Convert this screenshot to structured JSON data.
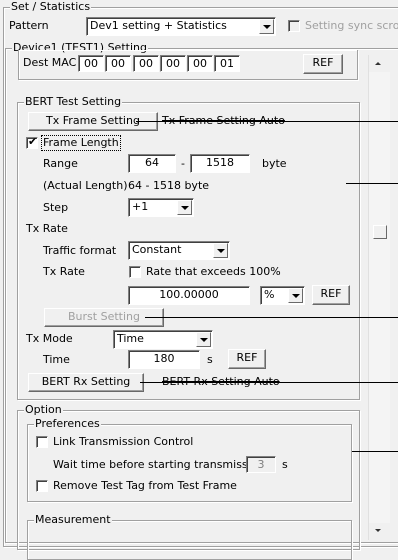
{
  "main_group": {
    "caption": "Set / Statistics"
  },
  "pattern": {
    "label": "Pattern",
    "value": "Dev1 setting + Statistics",
    "sync_label": "Setting sync scroll"
  },
  "device": {
    "caption": "Device1 (TEST1) Setting",
    "dest_mac_label": "Dest MAC",
    "mac_octets": [
      "00",
      "00",
      "00",
      "00",
      "00",
      "01"
    ],
    "ref_label": "REF"
  },
  "bert": {
    "caption": "BERT Test Setting",
    "tx_frame_button": "Tx Frame Setting",
    "tx_frame_auto": "Tx Frame Setting Auto",
    "frame_length_label": "Frame Length",
    "range_label": "Range",
    "range_min": "64",
    "range_sep": "-",
    "range_max": "1518",
    "range_unit": "byte",
    "actual_label": "(Actual Length)",
    "actual_value": "64 - 1518 byte",
    "step_label": "Step",
    "step_value": "+1",
    "tx_rate_header": "Tx Rate",
    "traffic_label": "Traffic format",
    "traffic_value": "Constant",
    "tx_rate_label": "Tx Rate",
    "exceed_label": "Rate that exceeds 100%",
    "rate_value": "100.00000",
    "rate_unit": "%",
    "rate_ref": "REF",
    "burst_button": "Burst Setting",
    "tx_mode_label": "Tx Mode",
    "tx_mode_value": "Time",
    "time_label": "Time",
    "time_value": "180",
    "time_unit": "s",
    "time_ref": "REF",
    "rx_button": "BERT Rx Setting",
    "rx_auto": "BERT Rx Setting Auto"
  },
  "option": {
    "caption": "Option",
    "preferences": {
      "caption": "Preferences",
      "link_label": "Link Transmission Control",
      "wait_label": "Wait time before starting transmission",
      "wait_value": "3",
      "wait_unit": "s",
      "remove_label": "Remove Test Tag from Test Frame"
    },
    "measurement_caption": "Measurement"
  }
}
